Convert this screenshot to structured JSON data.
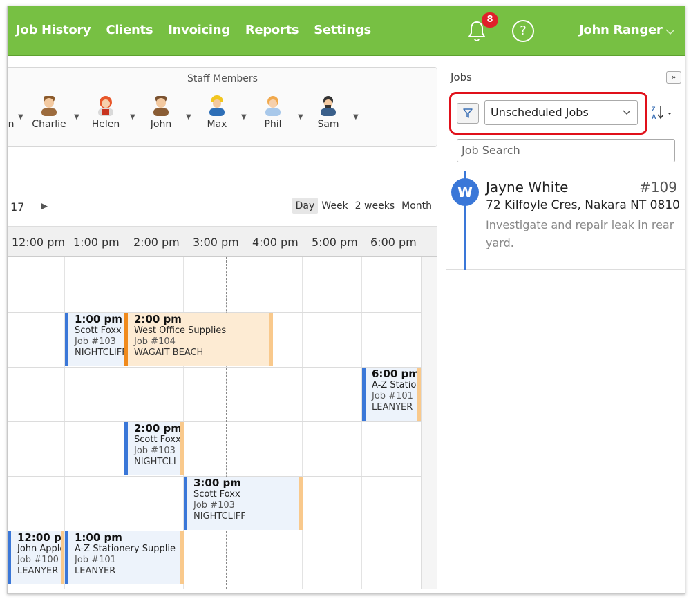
{
  "nav": {
    "links": [
      "Job History",
      "Clients",
      "Invoicing",
      "Reports",
      "Settings"
    ],
    "notification_count": "8",
    "help_symbol": "?",
    "user_name": "John Ranger"
  },
  "staff": {
    "title": "Staff Members",
    "partial_member": "n",
    "members": [
      "Charlie",
      "Helen",
      "John",
      "Max",
      "Phil",
      "Sam"
    ]
  },
  "calendar": {
    "date_fragment": "17",
    "views": [
      "Day",
      "Week",
      "2 weeks",
      "Month"
    ],
    "active_view": "Day",
    "time_labels": [
      "12:00 pm",
      "1:00 pm",
      "2:00 pm",
      "3:00 pm",
      "4:00 pm",
      "5:00 pm",
      "6:00 pm"
    ],
    "events": [
      {
        "time": "1:00 pm",
        "client": "Scott Foxx",
        "job": "Job #103",
        "location": "NIGHTCLIFF"
      },
      {
        "time": "2:00 pm",
        "client": "West Office Supplies",
        "job": "Job #104",
        "location": "WAGAIT BEACH"
      },
      {
        "time": "6:00 pm",
        "client": "A-Z Station",
        "job": "Job #101",
        "location": "LEANYER"
      },
      {
        "time": "2:00 pm",
        "client": "Scott Foxx",
        "job": "Job #103",
        "location": "NIGHTCLI"
      },
      {
        "time": "3:00 pm",
        "client": "Scott Foxx",
        "job": "Job #103",
        "location": "NIGHTCLIFF"
      },
      {
        "time": "12:00 pm",
        "client": "John Apple",
        "job": "Job #100",
        "location": "LEANYER"
      },
      {
        "time": "1:00 pm",
        "client": "A-Z Stationery Supplie",
        "job": "Job #101",
        "location": "LEANYER"
      }
    ]
  },
  "jobs_panel": {
    "title": "Jobs",
    "collapse_symbol": "»",
    "filter_value": "Unscheduled Jobs",
    "sort_label": "Z A",
    "search_placeholder": "Job Search",
    "job": {
      "initial": "W",
      "name": "Jayne White",
      "number": "#109",
      "address": "72 Kilfoyle Cres, Nakara NT 0810",
      "description": "Investigate and repair leak in rear yard."
    }
  },
  "colors": {
    "nav_green": "#77c043",
    "event_blue": "#3a77d8",
    "event_orange": "#f08a1c",
    "highlight_red": "#e0101a",
    "badge_red": "#e0202a"
  }
}
